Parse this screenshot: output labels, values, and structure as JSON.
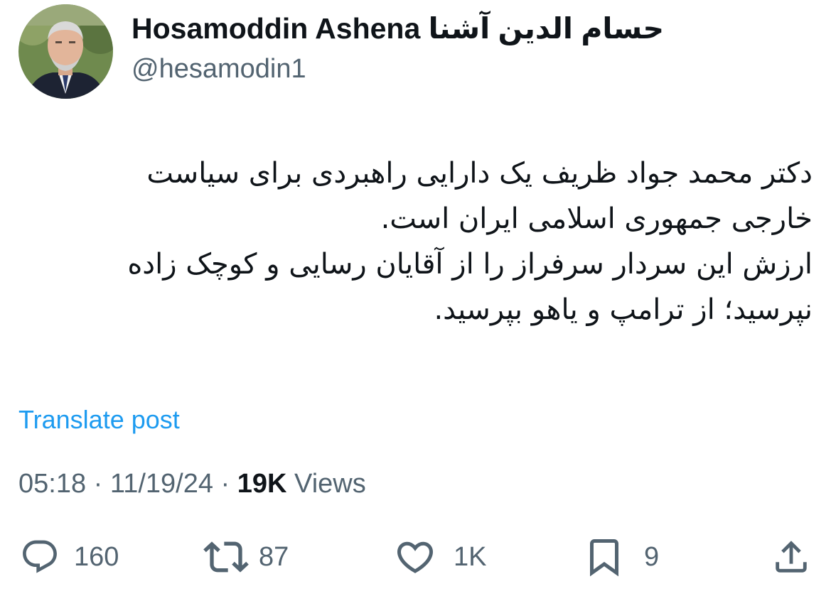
{
  "author": {
    "display_name": "Hosamoddin Ashena حسام الدين آشنا",
    "handle": "@hesamodin1"
  },
  "post": {
    "lines": [
      "دکتر محمد جواد ظریف یک دارایی راهبردی برای سیاست",
      "خارجی جمهوری اسلامی ایران است.",
      "ارزش این سردار سرفراز را از آقایان رسایی و کوچک زاده",
      "نپرسید؛ از ترامپ و یاهو  بپرسید."
    ],
    "translate_label": "Translate post",
    "time": "05:18",
    "date": "11/19/24",
    "separator": "·",
    "views_count": "19K",
    "views_label": "Views"
  },
  "actions": {
    "replies": {
      "icon": "reply-icon",
      "count": "160"
    },
    "reposts": {
      "icon": "repost-icon",
      "count": "87"
    },
    "likes": {
      "icon": "heart-icon",
      "count": "1K"
    },
    "bookmarks": {
      "icon": "bookmark-icon",
      "count": "9"
    },
    "share": {
      "icon": "share-icon"
    }
  },
  "colors": {
    "text": "#0f1419",
    "secondary": "#536471",
    "link": "#1d9bf0",
    "background": "#ffffff"
  }
}
